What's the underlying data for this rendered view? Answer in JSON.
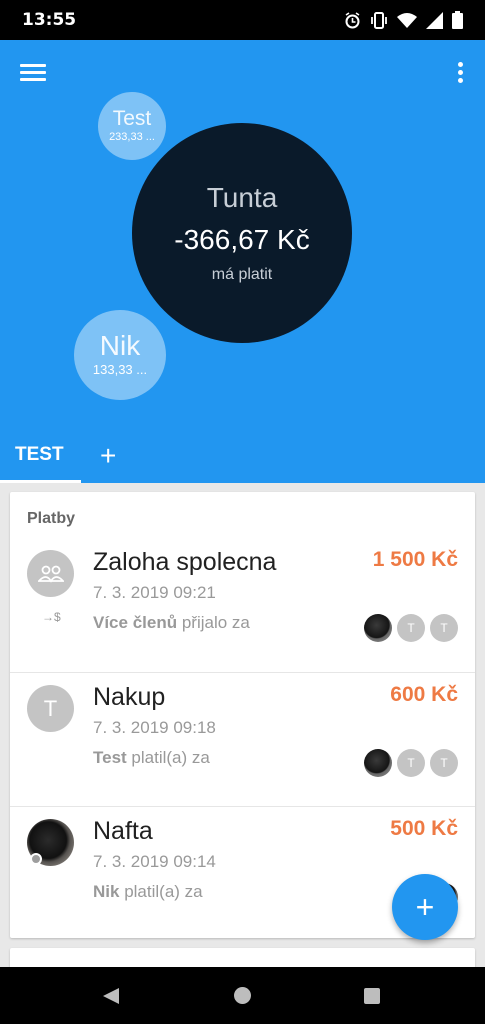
{
  "status_bar": {
    "time": "13:55",
    "icons": [
      "alarm-icon",
      "vibrate-icon",
      "wifi-icon",
      "signal-icon",
      "battery-icon"
    ]
  },
  "header": {
    "color": "#2296f0",
    "bubbles": {
      "test": {
        "name": "Test",
        "amount": "233,33 ..."
      },
      "nik": {
        "name": "Nik",
        "amount": "133,33 ..."
      },
      "main": {
        "name": "Tunta",
        "amount": "-366,67 Kč",
        "status": "má platit"
      }
    },
    "tabs": [
      {
        "label": "TEST",
        "active": true
      }
    ],
    "add_tab_label": "+"
  },
  "payments": {
    "title": "Platby",
    "rows": [
      {
        "avatar": "group-icon",
        "avatar_sub": "→$",
        "name": "Zaloha spolecna",
        "date": "7. 3. 2019 09:21",
        "desc_bold": "Více členů",
        "desc_rest": " přijalo za",
        "amount": "1 500 Kč",
        "chips": [
          "",
          "T",
          "T"
        ]
      },
      {
        "avatar": "T",
        "name": "Nakup",
        "date": "7. 3. 2019 09:18",
        "desc_bold": "Test",
        "desc_rest": " platil(a) za",
        "amount": "600 Kč",
        "chips": [
          "",
          "T",
          "T"
        ]
      },
      {
        "avatar": "photo",
        "name": "Nafta",
        "date": "7. 3. 2019 09:14",
        "desc_bold": "Nik",
        "desc_rest": " platil(a) za",
        "amount": "500 Kč",
        "chips": [
          ""
        ]
      }
    ]
  },
  "next_card": {
    "title": ""
  },
  "fab": {
    "label": "+"
  },
  "colors": {
    "amount": "#ee7a44",
    "accent": "#2296f0",
    "dark_bubble": "#0a1a2a"
  }
}
